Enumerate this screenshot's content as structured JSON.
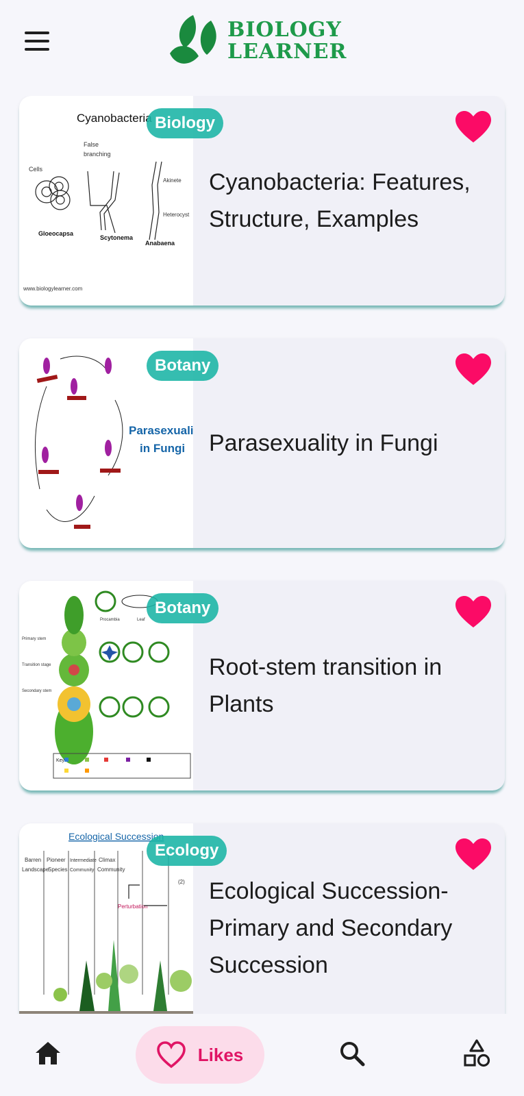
{
  "app": {
    "logo_line1": "BIOLOGY",
    "logo_line2": "LEARNER",
    "brand_color": "#1e9a4a"
  },
  "cards": [
    {
      "tag": "Biology",
      "title": "Cyanobacteria: Features, Structure, Examples",
      "liked": true,
      "thumb": {
        "heading": "Cyanobacteria",
        "labels": [
          "False",
          "branching",
          "Cells",
          "Akinete",
          "Heterocyst",
          "Gloeocapsa",
          "Scytonema",
          "Anabaena",
          "www.biologylearner.com"
        ]
      }
    },
    {
      "tag": "Botany",
      "title": "Parasexuality in Fungi",
      "liked": true,
      "thumb": {
        "heading_line1": "Parasexuality",
        "heading_line2": "in Fungi"
      }
    },
    {
      "tag": "Botany",
      "title": "Root-stem transition in Plants",
      "liked": true,
      "thumb": {
        "labels": [
          "Primary stem",
          "Transition stage",
          "Secondary stem",
          "Procambia",
          "Leaf",
          "Key"
        ]
      }
    },
    {
      "tag": "Ecology",
      "title": "Ecological Succession- Primary and Secondary Succession",
      "liked": true,
      "thumb": {
        "heading": "Ecological Succession",
        "labels": [
          "Barren",
          "Landscape",
          "Pioneer",
          "Species",
          "Intermediate",
          "Community",
          "Climax",
          "Community",
          "Perturbation",
          "(2)"
        ]
      }
    }
  ],
  "nav": {
    "likes_label": "Likes",
    "active": "likes",
    "heart_color": "#fb0b66",
    "likes_color": "#e01565"
  }
}
